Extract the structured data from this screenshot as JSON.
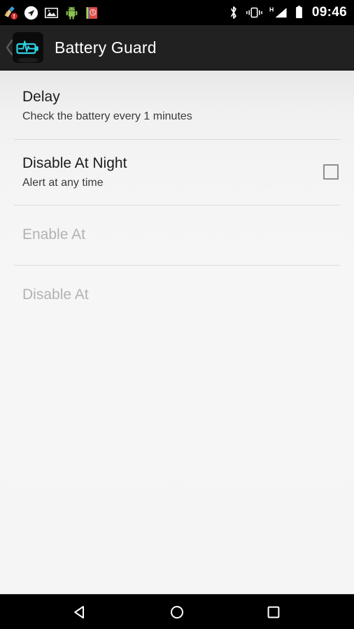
{
  "status_bar": {
    "left_icons": [
      {
        "name": "cleaner-broom-alert-icon",
        "label": "Cleaner"
      },
      {
        "name": "navigation-arrow-icon",
        "label": "Navigation"
      },
      {
        "name": "photo-image-icon",
        "label": "Gallery"
      },
      {
        "name": "android-robot-icon",
        "label": "Android"
      },
      {
        "name": "alarm-book-icon",
        "label": "Alarm"
      }
    ],
    "right_icons": [
      {
        "name": "bluetooth-icon",
        "label": "Bluetooth"
      },
      {
        "name": "vibrate-icon",
        "label": "Vibrate"
      },
      {
        "name": "signal-h-icon",
        "label": "H"
      },
      {
        "name": "battery-icon",
        "label": "Battery"
      }
    ],
    "clock": "09:46",
    "network_type": "H"
  },
  "action_bar": {
    "title": "Battery Guard",
    "up_icon": "back-chevron-icon",
    "app_icon": "battery-pulse-icon",
    "accent_color": "#2ed4e6",
    "background_color": "#212121"
  },
  "preferences": [
    {
      "key": "delay",
      "title": "Delay",
      "summary": "Check the battery every 1 minutes",
      "enabled": true,
      "widget": "none"
    },
    {
      "key": "disable_at_night",
      "title": "Disable At Night",
      "summary": "Alert at any time",
      "enabled": true,
      "widget": "checkbox",
      "checked": false
    },
    {
      "key": "enable_at",
      "title": "Enable At",
      "summary": "",
      "enabled": false,
      "widget": "none"
    },
    {
      "key": "disable_at",
      "title": "Disable At",
      "summary": "",
      "enabled": false,
      "widget": "none"
    }
  ],
  "nav_bar": {
    "back_label": "Back",
    "home_label": "Home",
    "recents_label": "Recent apps"
  }
}
